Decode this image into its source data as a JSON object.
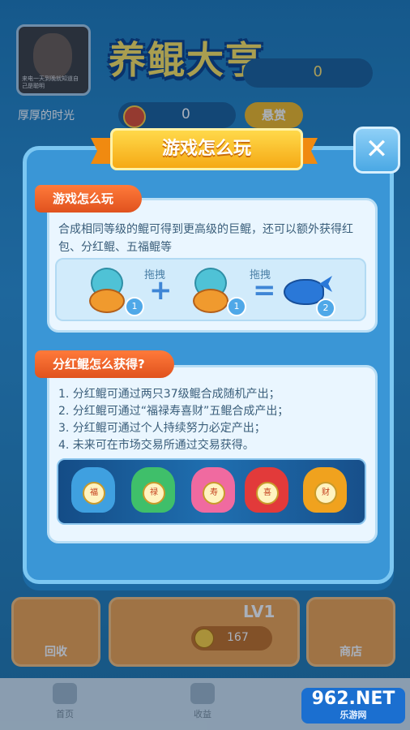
{
  "header": {
    "app_title": "养鲲大亨",
    "avatar_caption": "来电一天到晚就知道自己是聪明",
    "right_counter": "0",
    "user_name": "厚厚的时光",
    "coins": "0",
    "reward_label": "悬赏"
  },
  "modal": {
    "title": "游戏怎么玩",
    "close_symbol": "✕",
    "section1": {
      "tag": "游戏怎么玩",
      "text": "合成相同等级的鲲可得到更高级的巨鲲，还可以额外获得红包、分红鲲、五福鲲等",
      "drag_label_1": "拖拽",
      "drag_label_2": "拖拽",
      "plus": "+",
      "equals": "=",
      "level_a": "1",
      "level_b": "1",
      "level_result": "2"
    },
    "section2": {
      "tag": "分红鲲怎么获得?",
      "items": [
        "1. 分红鲲可通过两只37级鲲合成随机产出；",
        "2. 分红鲲可通过“福禄寿喜财”五鲲合成产出；",
        "3. 分红鲲可通过个人持续努力必定产出；",
        "4. 未来可在市场交易所通过交易获得。"
      ],
      "fish_chars": [
        "福",
        "禄",
        "寿",
        "喜",
        "财"
      ]
    }
  },
  "bottom": {
    "recycle_label": "回收",
    "level": "LV1",
    "price": "167",
    "shop_label": "商店"
  },
  "nav": {
    "home": "首页",
    "earnings": "收益"
  },
  "watermark": {
    "brand": "962.NET",
    "sub": "乐游网"
  }
}
